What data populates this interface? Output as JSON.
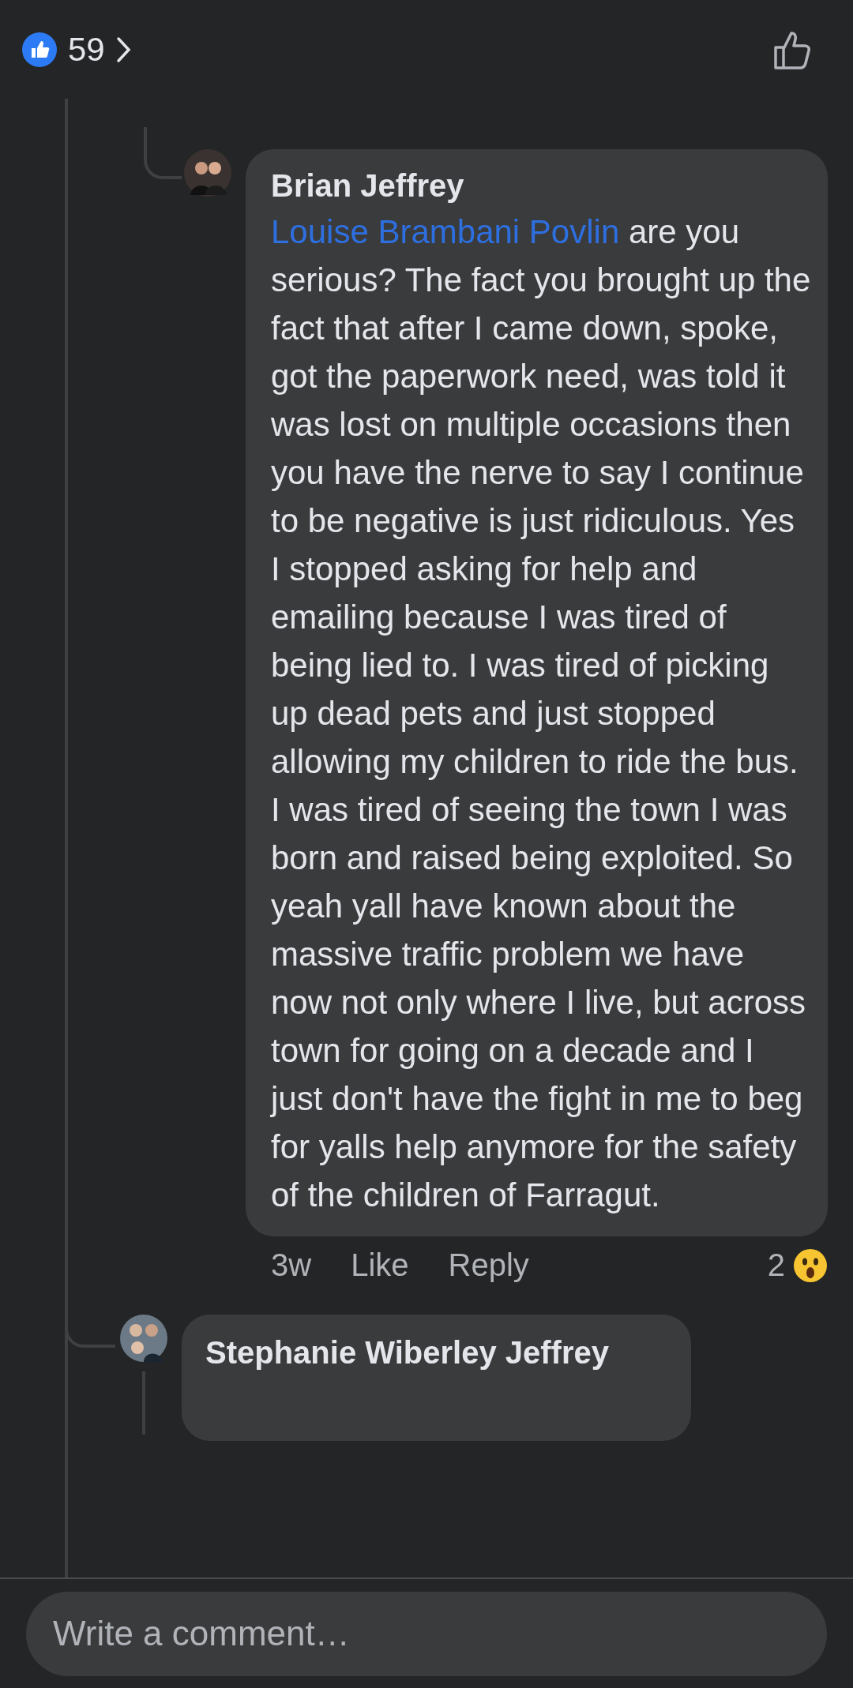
{
  "header": {
    "reaction_count": "59"
  },
  "comments": [
    {
      "author": "Brian Jeffrey",
      "mention": "Louise Brambani Povlin",
      "text": "are you serious? The fact you brought up the fact that after I came down, spoke, got the paperwork need, was told it was lost on multiple occasions then you have the nerve to say I continue to be negative is just ridiculous. Yes I stopped asking for help and emailing because I was tired of being lied to. I was tired of picking up dead pets and just stopped allowing my children to ride the bus. I was tired of seeing the town I was born and raised being exploited. So yeah yall have known about the massive traffic problem we have now not only where I live, but across town for going on a decade and I just don't have the fight in me to beg for yalls help anymore for the safety of the children of Farragut.",
      "time": "3w",
      "like": "Like",
      "reply": "Reply",
      "reaction_count": "2"
    },
    {
      "author": "Stephanie Wiberley Jeffrey"
    }
  ],
  "composer": {
    "placeholder": "Write a comment…"
  }
}
